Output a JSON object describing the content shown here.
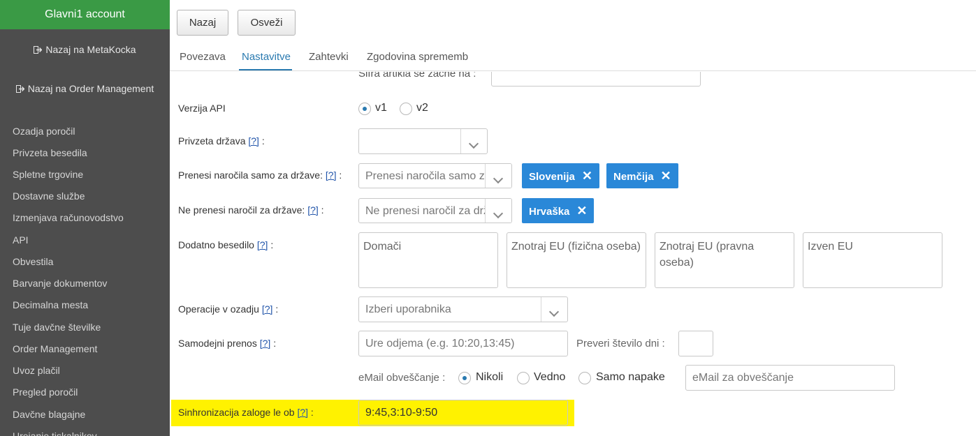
{
  "sidebar": {
    "account": "Glavni1 account",
    "links": [
      {
        "label": "Nazaj na MetaKocka"
      },
      {
        "label": "Nazaj na Order Management"
      }
    ],
    "items": [
      "Ozadja poročil",
      "Privzeta besedila",
      "Spletne trgovine",
      "Dostavne službe",
      "Izmenjava računovodstvo",
      "API",
      "Obvestila",
      "Barvanje dokumentov",
      "Decimalna mesta",
      "Tuje davčne številke",
      "Order Management",
      "Uvoz plačil",
      "Pregled poročil",
      "Davčne blagajne",
      "Urejanje tiskalnikov"
    ]
  },
  "toolbar": {
    "back": "Nazaj",
    "refresh": "Osveži"
  },
  "tabs": [
    "Povezava",
    "Nastavitve",
    "Zahtevki",
    "Zgodovina sprememb"
  ],
  "form": {
    "sku_label": "Šifra artikla se začne na :",
    "api_version_label": "Verzija API",
    "api_v1": "v1",
    "api_v2": "v2",
    "api_selected": "v1",
    "default_country_label": "Privzeta država",
    "help": "[?]",
    "colon": ":",
    "transfer_only_label": "Prenesi naročila samo za države:",
    "transfer_only_placeholder": "Prenesi naročila samo za države",
    "transfer_only_tags": [
      "Slovenija",
      "Nemčija"
    ],
    "no_transfer_label": "Ne prenesi naročil za države:",
    "no_transfer_placeholder": "Ne prenesi naročil za države",
    "no_transfer_tags": [
      "Hrvaška"
    ],
    "tag_remove": "✕",
    "extra_text_label": "Dodatno besedilo",
    "extra_text_fields": [
      "Domači",
      "Znotraj EU (fizična oseba)",
      "Znotraj EU (pravna oseba)",
      "Izven EU"
    ],
    "background_ops_label": "Operacije v ozadju",
    "background_ops_placeholder": "Izberi uporabnika",
    "auto_transfer_label": "Samodejni prenos",
    "auto_transfer_placeholder": "Ure odjema (e.g. 10:20,13:45)",
    "check_days_label": "Preveri število dni :",
    "email_notify_label": "eMail obveščanje :",
    "email_options": [
      "Nikoli",
      "Vedno",
      "Samo napake"
    ],
    "email_selected": "Nikoli",
    "email_placeholder": "eMail za obveščanje",
    "stock_sync_label": "Sinhronizacija zaloge le ob",
    "stock_sync_value": "9:45,3:10-9:50"
  },
  "colors": {
    "sidebar_bg": "#4d4d4d",
    "account_bg": "#3a9a45",
    "tag_bg": "#2a88d8",
    "accent": "#2a7ab0",
    "highlight": "#fff200"
  }
}
